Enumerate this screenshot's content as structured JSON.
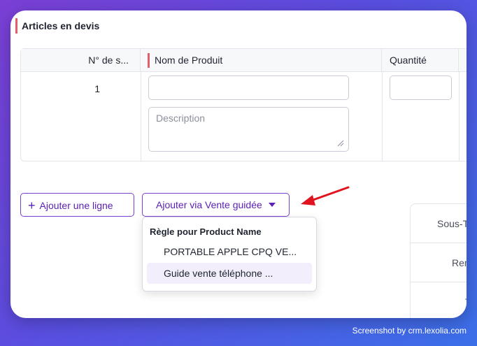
{
  "section": {
    "title": "Articles en devis"
  },
  "table": {
    "headers": {
      "number": "N° de s...",
      "product_name": "Nom de Produit",
      "quantity": "Quantité"
    },
    "row": {
      "number": "1",
      "product_value": "",
      "description_placeholder": "Description",
      "quantity_value": ""
    }
  },
  "buttons": {
    "add_line_label": "Ajouter une ligne",
    "add_line_icon": "plus-icon",
    "guided_sale_label": "Ajouter via Vente guidée",
    "guided_sale_icon": "caret-down-icon"
  },
  "dropdown": {
    "header": "Règle pour Product Name",
    "items": [
      "PORTABLE APPLE CPQ VE...",
      "Guide vente téléphone ..."
    ],
    "highlighted_index": 1
  },
  "totals": {
    "rows": [
      "Sous-T",
      "Rem",
      "T"
    ]
  },
  "annotation": {
    "arrow_color": "#e0141e"
  },
  "colors": {
    "accent": "#7a3fd0",
    "required_marker": "#e35d6a"
  },
  "footer": {
    "credit": "Screenshot by crm.lexolia.com"
  }
}
